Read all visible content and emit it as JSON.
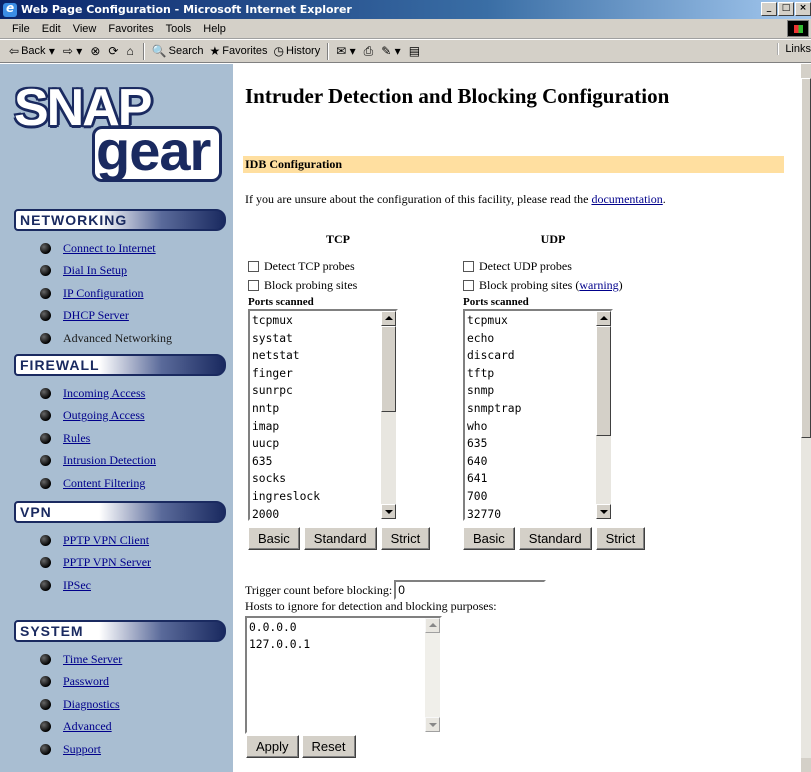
{
  "window": {
    "title": "Web Page Configuration - Microsoft Internet Explorer",
    "controls": [
      "_",
      "□",
      "×"
    ]
  },
  "menu": [
    "File",
    "Edit",
    "View",
    "Favorites",
    "Tools",
    "Help"
  ],
  "toolbar": {
    "back": "Back",
    "search": "Search",
    "favorites": "Favorites",
    "history": "History",
    "links": "Links"
  },
  "logo": {
    "top": "SNAP",
    "bottom": "gear"
  },
  "sidebar": {
    "networking": {
      "title": "NETWORKING",
      "items": [
        "Connect to Internet",
        "Dial In Setup",
        "IP Configuration",
        "DHCP Server",
        "Advanced Networking"
      ]
    },
    "firewall": {
      "title": "FIREWALL",
      "items": [
        "Incoming Access",
        "Outgoing Access",
        "Rules",
        "Intrusion Detection",
        "Content Filtering"
      ]
    },
    "vpn": {
      "title": "VPN",
      "items": [
        "PPTP VPN Client",
        "PPTP VPN Server",
        "IPSec"
      ]
    },
    "system": {
      "title": "SYSTEM",
      "items": [
        "Time Server",
        "Password",
        "Diagnostics",
        "Advanced",
        "Support"
      ]
    }
  },
  "main": {
    "title": "Intruder Detection and Blocking Configuration",
    "section": "IDB Configuration",
    "intro_prefix": "If you are unsure about the configuration of this facility, please read the ",
    "intro_link": "documentation",
    "intro_suffix": ".",
    "tcp": {
      "heading": "TCP",
      "detect_label": "Detect TCP probes",
      "block_label": "Block probing sites",
      "ports_label": "Ports scanned",
      "ports": [
        "tcpmux",
        "systat",
        "netstat",
        "finger",
        "sunrpc",
        "nntp",
        "imap",
        "uucp",
        "635",
        "socks",
        "ingreslock",
        "2000"
      ]
    },
    "udp": {
      "heading": "UDP",
      "detect_label": "Detect UDP probes",
      "block_label": "Block probing sites (",
      "block_link": "warning",
      "block_suffix": ")",
      "ports_label": "Ports scanned",
      "ports": [
        "tcpmux",
        "echo",
        "discard",
        "tftp",
        "snmp",
        "snmptrap",
        "who",
        "635",
        "640",
        "641",
        "700",
        "32770"
      ]
    },
    "preset_buttons": [
      "Basic",
      "Standard",
      "Strict"
    ],
    "trigger_label": "Trigger count before blocking:",
    "trigger_value": "0",
    "hosts_label": "Hosts to ignore for detection and blocking purposes:",
    "hosts": [
      "0.0.0.0",
      "127.0.0.1"
    ],
    "apply_label": "Apply",
    "reset_label": "Reset"
  }
}
